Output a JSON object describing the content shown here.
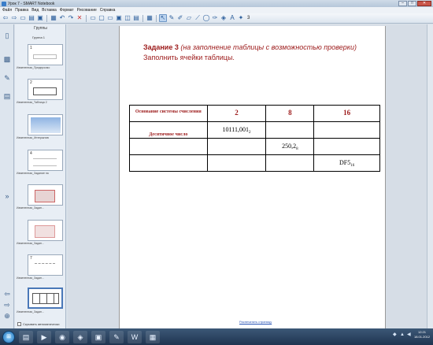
{
  "window": {
    "title": "Урок 7 - SMART Notebook",
    "minimize": "–",
    "maximize": "□",
    "close": "✕"
  },
  "menu": [
    "Файл",
    "Правка",
    "Вид",
    "Вставка",
    "Формат",
    "Рисование",
    "Справка"
  ],
  "toolbar": {
    "page_number": "3"
  },
  "sorter": {
    "header": "Группы",
    "group_label": "Группа 1",
    "thumbnails": [
      {
        "num": "1",
        "caption": "Измененная_Предпросмо"
      },
      {
        "num": "2",
        "caption": "Измененная_Таблица 2"
      },
      {
        "num": "",
        "caption": "Измененная_Интерактив"
      },
      {
        "num": "4",
        "caption": "Измененная_Задание на"
      },
      {
        "num": "",
        "caption": "Измененная_Задан..."
      },
      {
        "num": "",
        "caption": "Измененная_Задан..."
      },
      {
        "num": "7",
        "caption": "Измененная_Задан..."
      },
      {
        "num": "",
        "caption": "Измененная_Задан..."
      }
    ],
    "auto_hide_label": "Скрывать автоматически"
  },
  "page": {
    "task_title": "Задание 3",
    "task_note": "(на заполнение таблицы с возможностью проверки)",
    "task_instruction": "Заполнить ячейки  таблицы.",
    "footer_link": "Распечатать страницу"
  },
  "table": {
    "header_top": "Основание системы счисления",
    "header_bottom": "Десятичное число",
    "bases": [
      "2",
      "8",
      "16"
    ],
    "rows": [
      {
        "cells": [
          "",
          "10111,001",
          "",
          ""
        ],
        "subs": [
          "",
          "2",
          "",
          ""
        ]
      },
      {
        "cells": [
          "",
          "",
          "250,2",
          ""
        ],
        "subs": [
          "",
          "",
          "8",
          ""
        ]
      },
      {
        "cells": [
          "",
          "",
          "",
          "DF5"
        ],
        "subs": [
          "",
          "",
          "",
          "16"
        ]
      }
    ]
  },
  "taskbar": {
    "time": "12:21",
    "date": "18.01.2012"
  }
}
